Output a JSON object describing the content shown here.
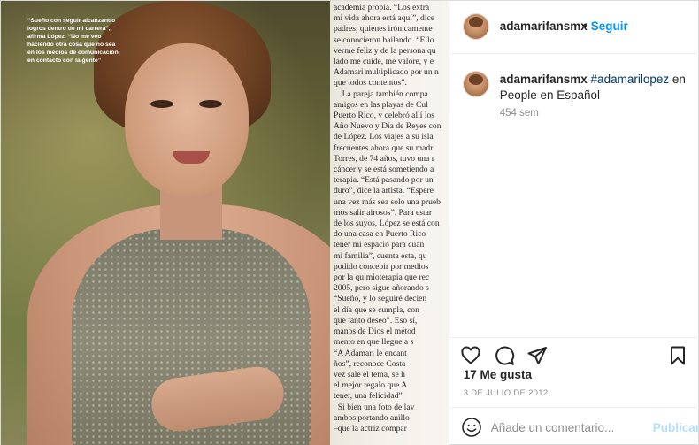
{
  "image": {
    "caption": "“Sueño con seguir alcanzando logros dentro de mi carrera”, afirma López. “No me veo haciendo otra cosa que no sea en los medios de comunicación, en contacto con la gente”",
    "magazine_text": "academia propia. “Los extra\nmi vida ahora está aquí”, dice\npadres, quienes irónicamente\nse conocieron bailando. “Ello\nverme feliz y de la persona qu\nlado me cuide, me valore, y e\nAdamari multiplicado por un n\nque todos contentos”.\n    La pareja también compa\namigos en las playas de Cul\nPuerto Rico, y celebró allí los\nAño Nuevo y Día de Reyes con\nde López. Los viajes a su isla\nfrecuentes ahora que su madr\nTorres, de 74 años, tuvo una r\ncáncer y se está sometiendo a\nterapia. “Está pasando por un\nduro”, dice la artista. “Espere\nuna vez más sea solo una prueb\nmos salir airosos”. Para estar\nde los suyos, López se está con\ndo una casa en Puerto Rico\ntener mi espacio para cuan\nmi familia”, cuenta esta, qu\npodido concebir por medios\npor la quimioterapia que rec\n2005, pero sigue añorando s\n“Sueño, y lo seguiré decien\nel día que se cumpla, con\nque tanto deseo”. Eso sí,\nmanos de Dios el métod\nmento en que llegue a s\n“A Adamari le encant\nños”, reconoce Costa\nvez sale el tema, se h\nel mejor regalo que A\ntener, una felicidad”\n  Si bien una foto de lav\nambos portando anillo\n–que la actriz compar"
  },
  "header": {
    "username": "adamarifansmx",
    "separator": "•",
    "follow_label": "Seguir"
  },
  "post": {
    "username": "adamarifansmx",
    "hashtag": "#adamarilopez",
    "caption_rest": " en People en Español",
    "time_ago": "454 sem"
  },
  "actions": {
    "icons": [
      "heart-icon",
      "comment-icon",
      "share-icon",
      "bookmark-icon"
    ],
    "likes": "17 Me gusta",
    "date": "3 DE JULIO DE 2012"
  },
  "add_comment": {
    "placeholder": "Añade un comentario...",
    "publish_label": "Publicar"
  },
  "colors": {
    "accent": "#0095f6",
    "publish_disabled": "#b2dffc",
    "hashtag": "#00376b",
    "muted": "#8e8e8e"
  }
}
